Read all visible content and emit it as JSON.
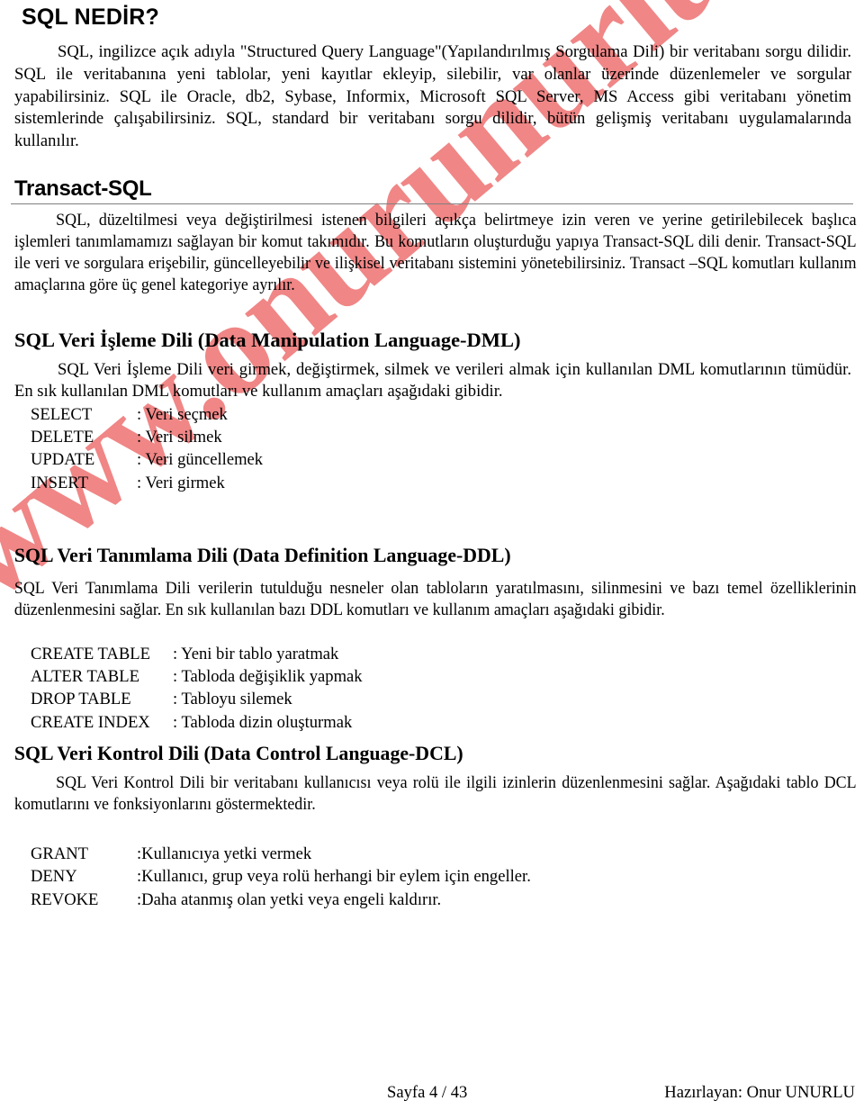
{
  "document": {
    "title": "SQL NEDİR?",
    "watermark": "www.onurunurlu.com",
    "watermark_color": "#f08080"
  },
  "intro": {
    "paragraph": "SQL, ingilizce açık adıyla \"Structured Query Language\"(Yapılandırılmış Sorgulama Dili) bir veritabanı sorgu dilidir. SQL ile veritabanına yeni tablolar, yeni kayıtlar ekleyip, silebilir, var olanlar üzerinde düzenlemeler ve sorgular yapabilirsiniz. SQL ile Oracle, db2, Sybase, Informix, Microsoft SQL Server, MS Access gibi veritabanı yönetim sistemlerinde çalışabilirsiniz. SQL, standard bir veritabanı sorgu dilidir, bütün gelişmiş veritabanı uygulamalarında kullanılır."
  },
  "transact": {
    "heading": "Transact-SQL",
    "paragraph": "SQL, düzeltilmesi veya değiştirilmesi istenen bilgileri açıkça belirtmeye izin veren ve yerine getirilebilecek başlıca işlemleri tanımlamamızı sağlayan bir komut takımıdır. Bu komutların oluşturduğu yapıya Transact-SQL dili denir. Transact-SQL ile veri ve sorgulara erişebilir, güncelleyebilir ve ilişkisel veritabanı sistemini yönetebilirsiniz. Transact –SQL komutları kullanım amaçlarına göre üç genel kategoriye ayrılır."
  },
  "dml": {
    "heading": "SQL Veri İşleme Dili (Data Manipulation Language-DML)",
    "paragraph": "SQL Veri İşleme Dili veri girmek, değiştirmek, silmek ve verileri almak için kullanılan DML komutlarının tümüdür. En sık kullanılan DML komutları ve kullanım amaçları aşağıdaki gibidir.",
    "commands": [
      {
        "name": "SELECT",
        "desc": ": Veri seçmek"
      },
      {
        "name": "DELETE",
        "desc": ": Veri silmek"
      },
      {
        "name": "UPDATE",
        "desc": ": Veri güncellemek"
      },
      {
        "name": "INSERT",
        "desc": ": Veri girmek"
      }
    ]
  },
  "ddl": {
    "heading": "SQL Veri Tanımlama Dili (Data Definition Language-DDL)",
    "paragraph": "SQL Veri Tanımlama Dili verilerin tutulduğu nesneler olan tabloların yaratılmasını, silinmesini ve bazı temel özelliklerinin düzenlenmesini sağlar. En sık kullanılan bazı DDL komutları ve kullanım amaçları aşağıdaki gibidir.",
    "commands": [
      {
        "name": "CREATE TABLE",
        "desc": ": Yeni bir tablo yaratmak"
      },
      {
        "name": "ALTER TABLE",
        "desc": ": Tabloda değişiklik yapmak"
      },
      {
        "name": "DROP TABLE",
        "desc": ": Tabloyu silemek"
      },
      {
        "name": "CREATE INDEX",
        "desc": ": Tabloda dizin oluşturmak"
      }
    ]
  },
  "dcl": {
    "heading": "SQL Veri Kontrol Dili (Data Control Language-DCL)",
    "paragraph": "SQL Veri Kontrol Dili bir veritabanı kullanıcısı veya rolü ile ilgili izinlerin düzenlenmesini sağlar. Aşağıdaki tablo DCL komutlarını ve fonksiyonlarını göstermektedir.",
    "commands": [
      {
        "name": "GRANT",
        "desc": ":Kullanıcıya yetki vermek"
      },
      {
        "name": "DENY",
        "desc": ":Kullanıcı, grup veya rolü herhangi bir eylem için engeller."
      },
      {
        "name": "REVOKE",
        "desc": ":Daha atanmış olan yetki veya engeli kaldırır."
      }
    ]
  },
  "footer": {
    "page_number": "Sayfa 4 / 43",
    "author": "Hazırlayan: Onur UNURLU"
  }
}
